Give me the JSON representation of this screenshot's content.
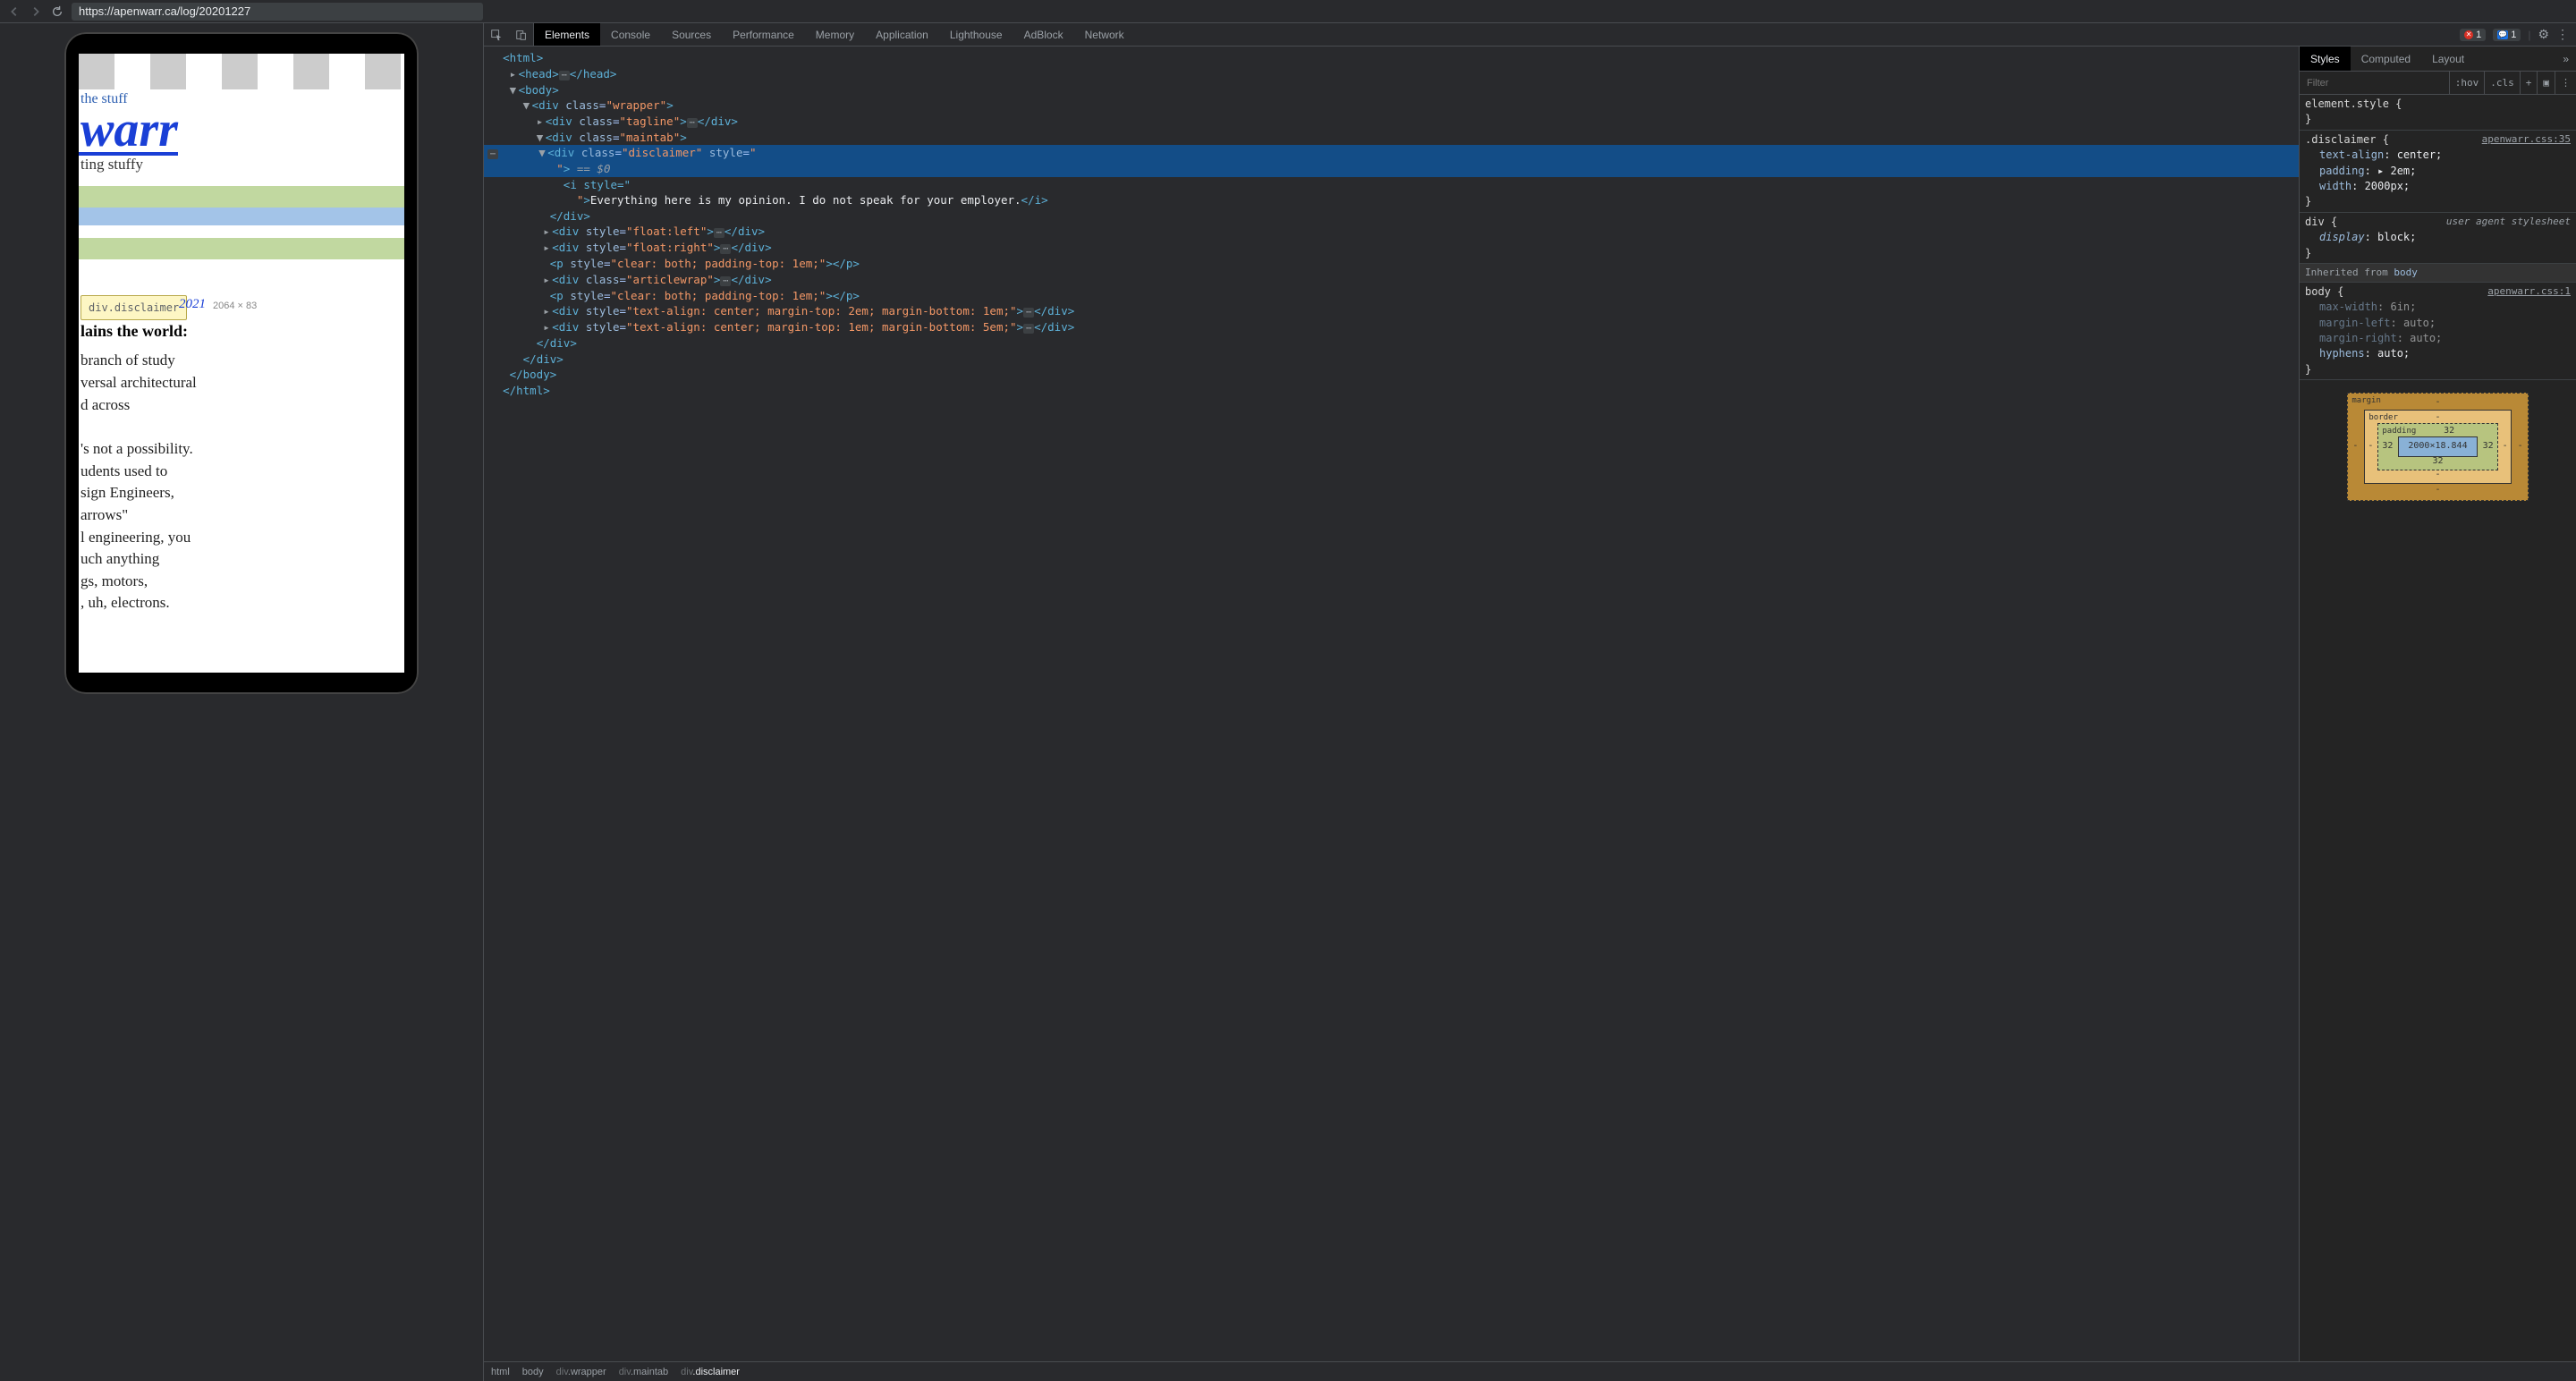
{
  "toolbar": {
    "url": "https://apenwarr.ca/log/20201227"
  },
  "viewport": {
    "tagline_top": "the stuff",
    "site_title": "warr",
    "tagline_bot": "ting stuffy",
    "tooltip_label": "div.disclaimer",
    "tooltip_link": "2021",
    "tooltip_dims": "2064 × 83",
    "article_heading": "lains the world:",
    "article_body": " branch of study\nversal architectural\nd across\n\n's not a possibility.\nudents used to\nsign Engineers,\narrows\"\nl engineering, you\nuch anything\ngs, motors,\n, uh, electrons."
  },
  "devtools": {
    "tabs": [
      "Elements",
      "Console",
      "Sources",
      "Performance",
      "Memory",
      "Application",
      "Lighthouse",
      "AdBlock",
      "Network"
    ],
    "active_tab": "Elements",
    "error_count": "1",
    "info_count": "1"
  },
  "dom": {
    "l0": "<html>",
    "l1": "<head>",
    "l1b": "</head>",
    "l2": "<body>",
    "l3_open": "<div ",
    "l3_cls": "class",
    "l3_wrap": "\"wrapper\"",
    "l4_tag": "\"tagline\"",
    "l5_main": "\"maintab\"",
    "l6_disc": "\"disclaimer\"",
    "l6_style": "style",
    "l6_sel": " == $0",
    "l7_istyle": "<i style=\"",
    "l8_txt": "Everything here is my opinion. I do not speak for your employer.",
    "l8_close": "</i>",
    "l9": "</div>",
    "l10_fl": "\"float:left\"",
    "l11_fr": "\"float:right\"",
    "l12_p": "\"clear: both; padding-top: 1em;\"",
    "l13_aw": "\"articlewrap\"",
    "l15_s": "\"text-align: center; margin-top: 2em; margin-bottom: 1em;\"",
    "l16_s": "\"text-align: center; margin-top: 1em; margin-bottom: 5em;\"",
    "close_div": "</div>",
    "close_body": "</body>",
    "close_html": "</html>"
  },
  "styles": {
    "tabs": [
      "Styles",
      "Computed",
      "Layout"
    ],
    "filter_ph": "Filter",
    "hov": ":hov",
    "cls": ".cls",
    "rule1_sel": "element.style {",
    "rule2_sel": ".disclaimer {",
    "rule2_src": "apenwarr.css:35",
    "rule2_p1n": "text-align",
    "rule2_p1v": "center;",
    "rule2_p2n": "padding",
    "rule2_p2v": "▸ 2em;",
    "rule2_p3n": "width",
    "rule2_p3v": "2000px;",
    "rule3_sel": "div {",
    "rule3_src": "user agent stylesheet",
    "rule3_p1n": "display",
    "rule3_p1v": "block;",
    "inherit_lbl": "Inherited from ",
    "inherit_el": "body",
    "rule4_sel": "body {",
    "rule4_src": "apenwarr.css:1",
    "rule4_p1n": "max-width",
    "rule4_p1v": "6in;",
    "rule4_p2n": "margin-left",
    "rule4_p2v": "auto;",
    "rule4_p3n": "margin-right",
    "rule4_p3v": "auto;",
    "rule4_p4n": "hyphens",
    "rule4_p4v": "auto;",
    "brace": "}",
    "bm": {
      "margin": "margin",
      "border": "border",
      "padding": "padding",
      "dash": "-",
      "pad_val": "32",
      "content": "2000×18.844"
    }
  },
  "crumbs": [
    "html",
    "body",
    "div.wrapper",
    "div.maintab",
    "div.disclaimer"
  ]
}
